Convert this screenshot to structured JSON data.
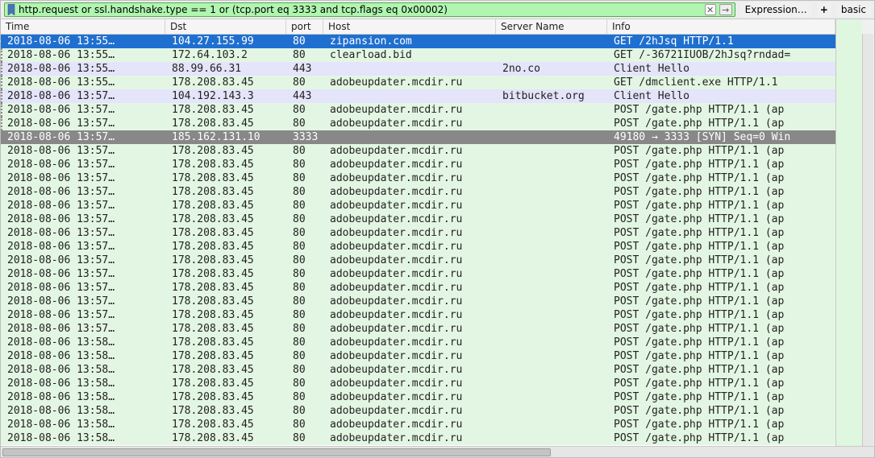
{
  "filter": {
    "value": "http.request or ssl.handshake.type == 1 or (tcp.port eq 3333 and tcp.flags eq 0x00002)",
    "expression_label": "Expression…",
    "plus_label": "+",
    "basic_label": "basic"
  },
  "columns": {
    "time": "Time",
    "dst": "Dst",
    "port": "port",
    "host": "Host",
    "server": "Server Name",
    "info": "Info"
  },
  "rows": [
    {
      "style": "selected",
      "marker": "current",
      "time": "2018-08-06 13:55…",
      "dst": "104.27.155.99",
      "port": "80",
      "host": "zipansion.com",
      "server": "",
      "info": "GET /2hJsq HTTP/1.1"
    },
    {
      "style": "green",
      "marker": "dot",
      "time": "2018-08-06 13:55…",
      "dst": "172.64.103.2",
      "port": "80",
      "host": "clearload.bid",
      "server": "",
      "info": "GET /-36721IUOB/2hJsq?rndad="
    },
    {
      "style": "purple",
      "marker": "dot",
      "time": "2018-08-06 13:55…",
      "dst": "88.99.66.31",
      "port": "443",
      "host": "",
      "server": "2no.co",
      "info": "Client Hello"
    },
    {
      "style": "green",
      "marker": "dot",
      "time": "2018-08-06 13:55…",
      "dst": "178.208.83.45",
      "port": "80",
      "host": "adobeupdater.mcdir.ru",
      "server": "",
      "info": "GET /dmclient.exe HTTP/1.1"
    },
    {
      "style": "purple",
      "marker": "dot",
      "time": "2018-08-06 13:57…",
      "dst": "104.192.143.3",
      "port": "443",
      "host": "",
      "server": "bitbucket.org",
      "info": "Client Hello"
    },
    {
      "style": "green",
      "marker": "dot",
      "time": "2018-08-06 13:57…",
      "dst": "178.208.83.45",
      "port": "80",
      "host": "adobeupdater.mcdir.ru",
      "server": "",
      "info": "POST /gate.php HTTP/1.1  (ap"
    },
    {
      "style": "green",
      "marker": "dot",
      "time": "2018-08-06 13:57…",
      "dst": "178.208.83.45",
      "port": "80",
      "host": "adobeupdater.mcdir.ru",
      "server": "",
      "info": "POST /gate.php HTTP/1.1  (ap"
    },
    {
      "style": "related",
      "marker": "",
      "time": "2018-08-06 13:57…",
      "dst": "185.162.131.10",
      "port": "3333",
      "host": "",
      "server": "",
      "info": "49180 → 3333 [SYN] Seq=0 Win"
    },
    {
      "style": "green",
      "marker": "",
      "time": "2018-08-06 13:57…",
      "dst": "178.208.83.45",
      "port": "80",
      "host": "adobeupdater.mcdir.ru",
      "server": "",
      "info": "POST /gate.php HTTP/1.1  (ap"
    },
    {
      "style": "green",
      "marker": "",
      "time": "2018-08-06 13:57…",
      "dst": "178.208.83.45",
      "port": "80",
      "host": "adobeupdater.mcdir.ru",
      "server": "",
      "info": "POST /gate.php HTTP/1.1  (ap"
    },
    {
      "style": "green",
      "marker": "",
      "time": "2018-08-06 13:57…",
      "dst": "178.208.83.45",
      "port": "80",
      "host": "adobeupdater.mcdir.ru",
      "server": "",
      "info": "POST /gate.php HTTP/1.1  (ap"
    },
    {
      "style": "green",
      "marker": "",
      "time": "2018-08-06 13:57…",
      "dst": "178.208.83.45",
      "port": "80",
      "host": "adobeupdater.mcdir.ru",
      "server": "",
      "info": "POST /gate.php HTTP/1.1  (ap"
    },
    {
      "style": "green",
      "marker": "",
      "time": "2018-08-06 13:57…",
      "dst": "178.208.83.45",
      "port": "80",
      "host": "adobeupdater.mcdir.ru",
      "server": "",
      "info": "POST /gate.php HTTP/1.1  (ap"
    },
    {
      "style": "green",
      "marker": "",
      "time": "2018-08-06 13:57…",
      "dst": "178.208.83.45",
      "port": "80",
      "host": "adobeupdater.mcdir.ru",
      "server": "",
      "info": "POST /gate.php HTTP/1.1  (ap"
    },
    {
      "style": "green",
      "marker": "",
      "time": "2018-08-06 13:57…",
      "dst": "178.208.83.45",
      "port": "80",
      "host": "adobeupdater.mcdir.ru",
      "server": "",
      "info": "POST /gate.php HTTP/1.1  (ap"
    },
    {
      "style": "green",
      "marker": "",
      "time": "2018-08-06 13:57…",
      "dst": "178.208.83.45",
      "port": "80",
      "host": "adobeupdater.mcdir.ru",
      "server": "",
      "info": "POST /gate.php HTTP/1.1  (ap"
    },
    {
      "style": "green",
      "marker": "",
      "time": "2018-08-06 13:57…",
      "dst": "178.208.83.45",
      "port": "80",
      "host": "adobeupdater.mcdir.ru",
      "server": "",
      "info": "POST /gate.php HTTP/1.1  (ap"
    },
    {
      "style": "green",
      "marker": "",
      "time": "2018-08-06 13:57…",
      "dst": "178.208.83.45",
      "port": "80",
      "host": "adobeupdater.mcdir.ru",
      "server": "",
      "info": "POST /gate.php HTTP/1.1  (ap"
    },
    {
      "style": "green",
      "marker": "",
      "time": "2018-08-06 13:57…",
      "dst": "178.208.83.45",
      "port": "80",
      "host": "adobeupdater.mcdir.ru",
      "server": "",
      "info": "POST /gate.php HTTP/1.1  (ap"
    },
    {
      "style": "green",
      "marker": "",
      "time": "2018-08-06 13:57…",
      "dst": "178.208.83.45",
      "port": "80",
      "host": "adobeupdater.mcdir.ru",
      "server": "",
      "info": "POST /gate.php HTTP/1.1  (ap"
    },
    {
      "style": "green",
      "marker": "",
      "time": "2018-08-06 13:57…",
      "dst": "178.208.83.45",
      "port": "80",
      "host": "adobeupdater.mcdir.ru",
      "server": "",
      "info": "POST /gate.php HTTP/1.1  (ap"
    },
    {
      "style": "green",
      "marker": "",
      "time": "2018-08-06 13:57…",
      "dst": "178.208.83.45",
      "port": "80",
      "host": "adobeupdater.mcdir.ru",
      "server": "",
      "info": "POST /gate.php HTTP/1.1  (ap"
    },
    {
      "style": "green",
      "marker": "",
      "time": "2018-08-06 13:58…",
      "dst": "178.208.83.45",
      "port": "80",
      "host": "adobeupdater.mcdir.ru",
      "server": "",
      "info": "POST /gate.php HTTP/1.1  (ap"
    },
    {
      "style": "green",
      "marker": "",
      "time": "2018-08-06 13:58…",
      "dst": "178.208.83.45",
      "port": "80",
      "host": "adobeupdater.mcdir.ru",
      "server": "",
      "info": "POST /gate.php HTTP/1.1  (ap"
    },
    {
      "style": "green",
      "marker": "",
      "time": "2018-08-06 13:58…",
      "dst": "178.208.83.45",
      "port": "80",
      "host": "adobeupdater.mcdir.ru",
      "server": "",
      "info": "POST /gate.php HTTP/1.1  (ap"
    },
    {
      "style": "green",
      "marker": "",
      "time": "2018-08-06 13:58…",
      "dst": "178.208.83.45",
      "port": "80",
      "host": "adobeupdater.mcdir.ru",
      "server": "",
      "info": "POST /gate.php HTTP/1.1  (ap"
    },
    {
      "style": "green",
      "marker": "",
      "time": "2018-08-06 13:58…",
      "dst": "178.208.83.45",
      "port": "80",
      "host": "adobeupdater.mcdir.ru",
      "server": "",
      "info": "POST /gate.php HTTP/1.1  (ap"
    },
    {
      "style": "green",
      "marker": "",
      "time": "2018-08-06 13:58…",
      "dst": "178.208.83.45",
      "port": "80",
      "host": "adobeupdater.mcdir.ru",
      "server": "",
      "info": "POST /gate.php HTTP/1.1  (ap"
    },
    {
      "style": "green",
      "marker": "",
      "time": "2018-08-06 13:58…",
      "dst": "178.208.83.45",
      "port": "80",
      "host": "adobeupdater.mcdir.ru",
      "server": "",
      "info": "POST /gate.php HTTP/1.1  (ap"
    },
    {
      "style": "green",
      "marker": "",
      "time": "2018-08-06 13:58…",
      "dst": "178.208.83.45",
      "port": "80",
      "host": "adobeupdater.mcdir.ru",
      "server": "",
      "info": "POST /gate.php HTTP/1.1  (ap"
    }
  ]
}
